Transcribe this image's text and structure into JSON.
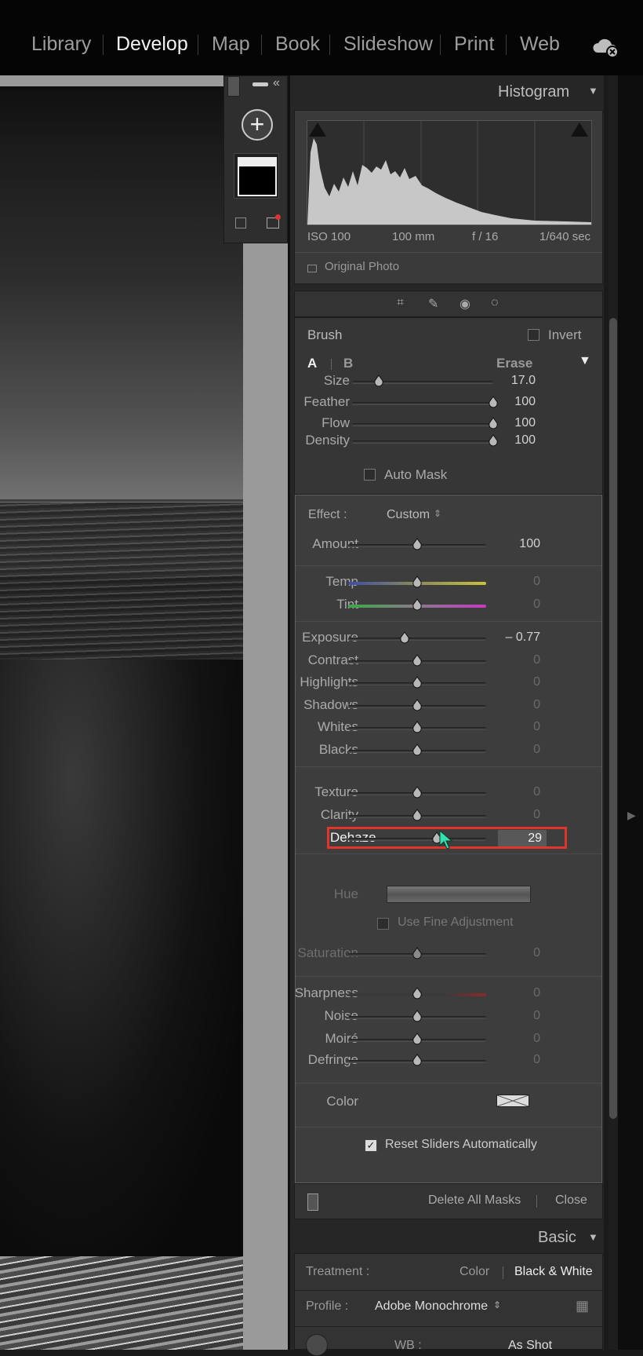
{
  "modules": [
    "Library",
    "Develop",
    "Map",
    "Book",
    "Slideshow",
    "Print",
    "Web"
  ],
  "active_module": "Develop",
  "histogram": {
    "title": "Histogram",
    "iso": "ISO 100",
    "focal": "100 mm",
    "aperture": "f / 16",
    "shutter": "1/640 sec",
    "original_photo": "Original Photo"
  },
  "brush": {
    "title": "Brush",
    "invert": "Invert",
    "tab_a": "A",
    "tab_b": "B",
    "erase": "Erase",
    "sliders": [
      {
        "label": "Size",
        "value": "17.0",
        "fraction": 0.19
      },
      {
        "label": "Feather",
        "value": "100",
        "fraction": 1.0
      },
      {
        "label": "Flow",
        "value": "100",
        "fraction": 1.0
      },
      {
        "label": "Density",
        "value": "100",
        "fraction": 1.0
      }
    ],
    "auto_mask": "Auto Mask"
  },
  "effect": {
    "label": "Effect :",
    "preset": "Custom",
    "amount": {
      "label": "Amount",
      "value": "100",
      "fraction": 0.5
    },
    "color_sliders": [
      {
        "label": "Temp",
        "value": "0",
        "fraction": 0.5,
        "track": "temp"
      },
      {
        "label": "Tint",
        "value": "0",
        "fraction": 0.5,
        "track": "tint"
      }
    ],
    "tone_sliders": [
      {
        "label": "Exposure",
        "value": "– 0.77",
        "fraction": 0.41
      },
      {
        "label": "Contrast",
        "value": "0",
        "fraction": 0.5
      },
      {
        "label": "Highlights",
        "value": "0",
        "fraction": 0.5
      },
      {
        "label": "Shadows",
        "value": "0",
        "fraction": 0.5
      },
      {
        "label": "Whites",
        "value": "0",
        "fraction": 0.5
      },
      {
        "label": "Blacks",
        "value": "0",
        "fraction": 0.5
      }
    ],
    "presence_sliders": [
      {
        "label": "Texture",
        "value": "0",
        "fraction": 0.5
      },
      {
        "label": "Clarity",
        "value": "0",
        "fraction": 0.5
      },
      {
        "label": "Dehaze",
        "value": "29",
        "fraction": 0.64,
        "highlight": true
      }
    ],
    "hue": "Hue",
    "use_fine_adjustment": "Use Fine Adjustment",
    "saturation": {
      "label": "Saturation",
      "value": "0",
      "fraction": 0.5
    },
    "detail_sliders": [
      {
        "label": "Sharpness",
        "value": "0",
        "fraction": 0.5
      },
      {
        "label": "Noise",
        "value": "0",
        "fraction": 0.5
      },
      {
        "label": "Moiré",
        "value": "0",
        "fraction": 0.5
      },
      {
        "label": "Defringe",
        "value": "0",
        "fraction": 0.5
      }
    ],
    "color": "Color",
    "reset_sliders": "Reset Sliders Automatically"
  },
  "footer": {
    "delete_all_masks": "Delete All Masks",
    "close": "Close"
  },
  "basic": {
    "title": "Basic",
    "treatment_label": "Treatment :",
    "treatment_color": "Color",
    "treatment_bw": "Black & White",
    "profile_label": "Profile :",
    "profile_value": "Adobe Monochrome",
    "wb_label": "WB :",
    "wb_value": "As Shot"
  },
  "colors": {
    "highlight": "#e0352b",
    "cursor": "#35e0b0"
  }
}
